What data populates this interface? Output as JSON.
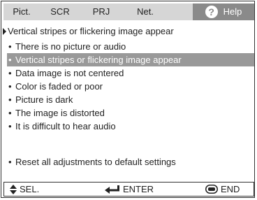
{
  "tabs": [
    {
      "label": "Pict.",
      "active": false
    },
    {
      "label": "SCR",
      "active": false
    },
    {
      "label": "PRJ",
      "active": false
    },
    {
      "label": "Net.",
      "active": false
    },
    {
      "label": "Help",
      "active": true,
      "icon": "question-mark-icon"
    }
  ],
  "heading": "Vertical stripes or flickering image appear",
  "items": [
    {
      "label": "There is no picture or audio"
    },
    {
      "label": "Vertical stripes or flickering image appear",
      "selected": true
    },
    {
      "label": "Data image is not centered"
    },
    {
      "label": "Color is faded or poor"
    },
    {
      "label": "Picture is dark"
    },
    {
      "label": "The image is distorted"
    },
    {
      "label": "It is difficult to hear audio"
    }
  ],
  "reset_label": "Reset all adjustments to default settings",
  "footer": {
    "sel_label": "SEL.",
    "enter_label": "ENTER",
    "end_label": "END"
  },
  "colors": {
    "tab_bar": "#d6d6d6",
    "active_tab": "#8a8a8a",
    "selected_row": "#999999",
    "text": "#222222"
  }
}
